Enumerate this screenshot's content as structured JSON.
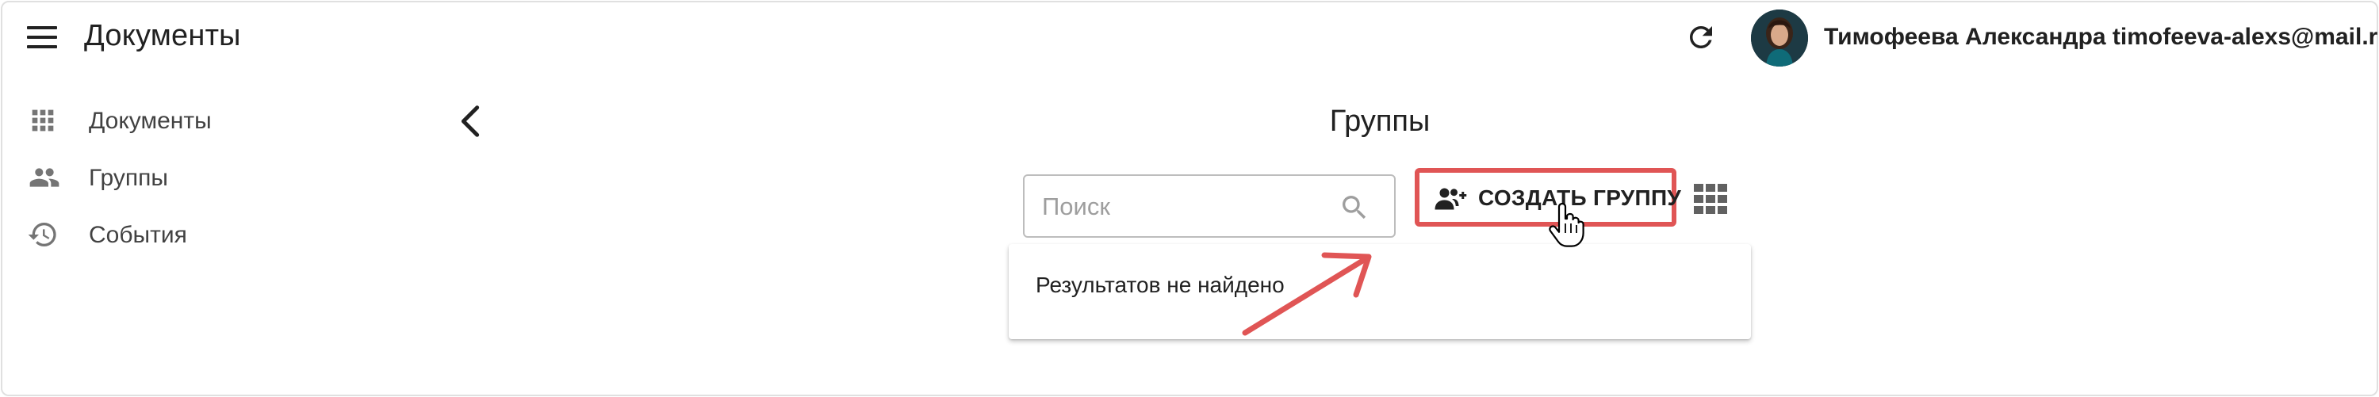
{
  "header": {
    "app_title": "Документы",
    "user_name": "Тимофеева Александра",
    "user_email": "timofeeva-alexs@mail.ru",
    "refresh_icon": "refresh-icon",
    "menu_icon": "hamburger-menu-icon"
  },
  "sidebar": {
    "items": [
      {
        "label": "Документы",
        "icon": "apps-grid-icon"
      },
      {
        "label": "Группы",
        "icon": "people-icon"
      },
      {
        "label": "События",
        "icon": "history-icon"
      }
    ]
  },
  "main": {
    "title": "Группы",
    "search": {
      "placeholder": "Поиск",
      "value": ""
    },
    "create_button_label": "СОЗДАТЬ ГРУППУ",
    "no_results_text": "Результатов не найдено"
  },
  "colors": {
    "highlight": "#e05555",
    "text": "#212121",
    "border": "#bdbdbd"
  }
}
